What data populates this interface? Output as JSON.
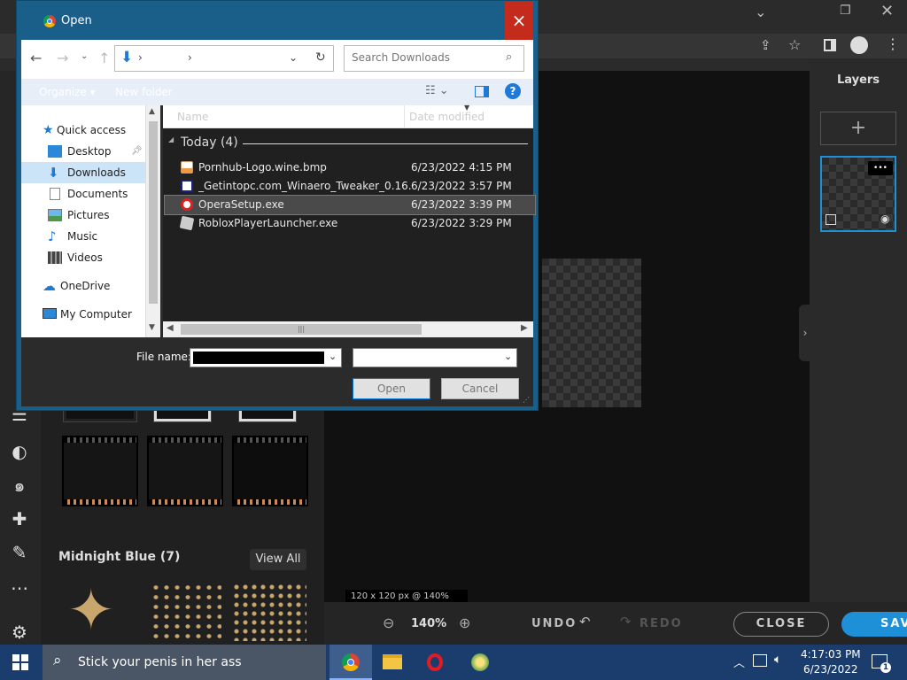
{
  "dialog": {
    "title": "Open",
    "address_sep1": "›",
    "address_sep2": "›",
    "search_placeholder": "Search Downloads",
    "organize_label": "Organize ▾",
    "new_folder_label": "New folder",
    "col_name": "Name",
    "col_date": "Date modified",
    "group_label": "Today (4)",
    "tree": [
      {
        "label": "Quick access"
      },
      {
        "label": "Desktop"
      },
      {
        "label": "Downloads"
      },
      {
        "label": "Documents"
      },
      {
        "label": "Pictures"
      },
      {
        "label": "Music"
      },
      {
        "label": "Videos"
      },
      {
        "label": "OneDrive"
      },
      {
        "label": "My Computer"
      }
    ],
    "files": [
      {
        "name": "Pornhub-Logo.wine.bmp",
        "date": "6/23/2022 4:15 PM"
      },
      {
        "name": "_Getintopc.com_Winaero_Tweaker_0.16.1...",
        "date": "6/23/2022 3:57 PM"
      },
      {
        "name": "OperaSetup.exe",
        "date": "6/23/2022 3:39 PM"
      },
      {
        "name": "RobloxPlayerLauncher.exe",
        "date": "6/23/2022 3:29 PM"
      }
    ],
    "filename_label": "File name:",
    "filename_value": "",
    "open_label": "Open",
    "cancel_label": "Cancel",
    "close_glyph": "×"
  },
  "app": {
    "layers_title": "Layers",
    "add_glyph": "+",
    "more_glyph": "•••",
    "section_title": "Midnight Blue (7)",
    "view_all": "View All",
    "canvas_info": "120 x 120 px @ 140%",
    "zoom_level": "140%",
    "undo_label": "UNDO",
    "redo_label": "REDO",
    "close_label": "CLOSE",
    "save_label": "SAV"
  },
  "taskbar": {
    "search_text": "Stick your penis in her ass",
    "time": "4:17:03 PM",
    "date": "6/23/2022",
    "notif_count": "1"
  },
  "colors": {
    "dialog_frame": "#1a5f8a",
    "selection": "#cce4f7",
    "accent": "#1e90d8",
    "close_red": "#c42b1c"
  }
}
